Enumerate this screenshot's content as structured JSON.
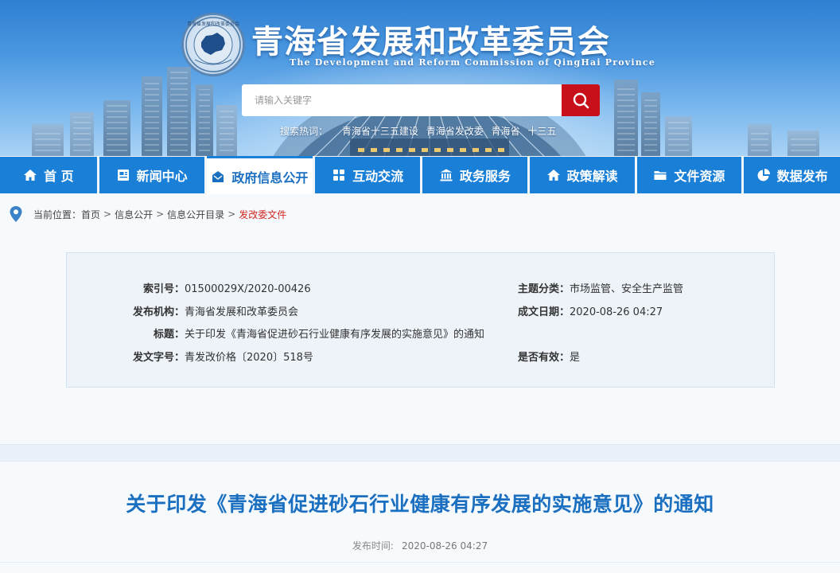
{
  "header": {
    "title": "青海省发展和改革委员会",
    "subtitle": "The Development and Reform Commission of QingHai Province",
    "logo_text": "青海省发展和改革委员会",
    "search": {
      "placeholder": "请输入关键字"
    },
    "hotwords_label": "搜索热词：",
    "hotwords": [
      "青海省十三五建设",
      "青海省发改委",
      "青海省",
      "十三五"
    ]
  },
  "nav": {
    "items": [
      {
        "label": "首 页",
        "icon": "home-icon"
      },
      {
        "label": "新闻中心",
        "icon": "news-icon"
      },
      {
        "label": "政府信息公开",
        "icon": "envelope-icon",
        "active": true
      },
      {
        "label": "互动交流",
        "icon": "grid-icon"
      },
      {
        "label": "政务服务",
        "icon": "bank-icon"
      },
      {
        "label": "政策解读",
        "icon": "home-icon"
      },
      {
        "label": "文件资源",
        "icon": "folder-icon"
      },
      {
        "label": "数据发布",
        "icon": "pie-chart-icon"
      }
    ]
  },
  "breadcrumb": {
    "label": "当前位置：",
    "items": [
      "首页",
      "信息公开",
      "信息公开目录"
    ],
    "current": "发改委文件",
    "separator": ">"
  },
  "info": {
    "index_no": {
      "key": "索引号：",
      "value": "01500029X/2020-00426"
    },
    "topic": {
      "key": "主题分类：",
      "value": "市场监管、安全生产监管"
    },
    "publisher": {
      "key": "发布机构：",
      "value": "青海省发展和改革委员会"
    },
    "date": {
      "key": "成文日期：",
      "value": "2020-08-26 04:27"
    },
    "title": {
      "key": "标题：",
      "value": "关于印发《青海省促进砂石行业健康有序发展的实施意见》的通知"
    },
    "doc_no": {
      "key": "发文字号：",
      "value": "青发改价格〔2020〕518号"
    },
    "valid": {
      "key": "是否有效：",
      "value": "是"
    }
  },
  "article": {
    "title": "关于印发《青海省促进砂石行业健康有序发展的实施意见》的通知",
    "publish_label": "发布时间:",
    "publish_time": "2020-08-26 04:27"
  },
  "colors": {
    "nav_blue": "#1a7fd6",
    "title_blue": "#1a6fc0",
    "search_red": "#c8101b",
    "crumb_current": "#d0261e"
  }
}
